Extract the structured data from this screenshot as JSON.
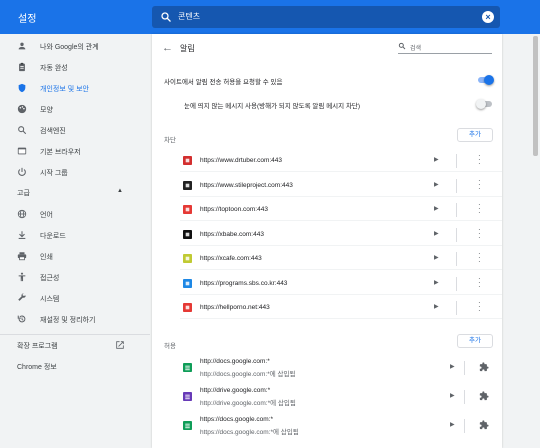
{
  "app": {
    "title": "설정"
  },
  "search": {
    "value": "콘텐츠"
  },
  "sidebar": {
    "items": [
      {
        "label": "나와 Google의 관계",
        "icon": "person-icon"
      },
      {
        "label": "자동 완성",
        "icon": "clipboard-icon"
      },
      {
        "label": "개인정보 및 보안",
        "icon": "shield-icon",
        "active": true
      },
      {
        "label": "모양",
        "icon": "palette-icon"
      },
      {
        "label": "검색엔진",
        "icon": "search-icon"
      },
      {
        "label": "기본 브라우저",
        "icon": "browser-icon"
      },
      {
        "label": "시작 그룹",
        "icon": "power-icon"
      }
    ],
    "advanced_label": "고급",
    "advanced_items": [
      {
        "label": "언어",
        "icon": "globe-icon"
      },
      {
        "label": "다운로드",
        "icon": "download-icon"
      },
      {
        "label": "인쇄",
        "icon": "printer-icon"
      },
      {
        "label": "접근성",
        "icon": "accessibility-icon"
      },
      {
        "label": "시스템",
        "icon": "wrench-icon"
      },
      {
        "label": "재설정 및 정리하기",
        "icon": "history-icon"
      }
    ],
    "extensions_label": "확장 프로그램",
    "about_label": "Chrome 정보"
  },
  "page": {
    "title": "알림",
    "search_placeholder": "검색",
    "toggle1_label": "사이트에서 알림 전송 허용을 요청할 수 있음",
    "toggle1_on": true,
    "toggle2_label": "눈에 띄지 않는 메시지 사용(방해가 되지 않도록 알림 메시지 차단)",
    "toggle2_on": false,
    "block_label": "차단",
    "add_label": "추가",
    "blocked": [
      {
        "url": "https://www.drtuber.com:443",
        "favicon_color": "#d32f2f"
      },
      {
        "url": "https://www.stileproject.com:443",
        "favicon_color": "#222222"
      },
      {
        "url": "https://toptoon.com:443",
        "favicon_color": "#e53935"
      },
      {
        "url": "https://xbabe.com:443",
        "favicon_color": "#111111"
      },
      {
        "url": "https://xcafe.com:443",
        "favicon_color": "#c0ca33"
      },
      {
        "url": "https://programs.sbs.co.kr:443",
        "favicon_color": "#1e88e5"
      },
      {
        "url": "https://hellporno.net:443",
        "favicon_color": "#e53935"
      }
    ],
    "allow_label": "허용",
    "allow_add_label": "추가",
    "allowed": [
      {
        "url": "http://docs.google.com:*",
        "sub": "http://docs.google.com:*에 삽입됨",
        "favicon_color": "#0f9d58"
      },
      {
        "url": "http://drive.google.com:*",
        "sub": "http://drive.google.com:*에 삽입됨",
        "favicon_color": "#673ab7"
      },
      {
        "url": "https://docs.google.com:*",
        "sub": "https://docs.google.com:*에 삽입됨",
        "favicon_color": "#0f9d58"
      }
    ]
  }
}
